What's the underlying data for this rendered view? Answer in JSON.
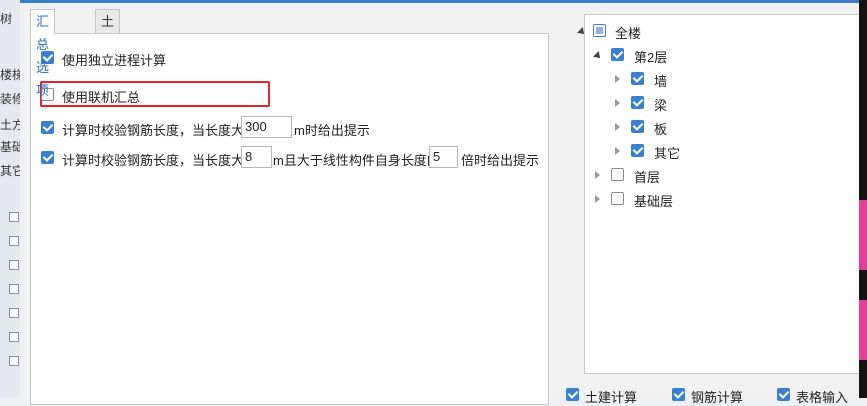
{
  "background_app": {
    "top_label": "树",
    "items": [
      "楼梯",
      "装修",
      "土方",
      "基础",
      "其它"
    ]
  },
  "dialog": {
    "tabs": [
      {
        "label": "汇总选项",
        "active": true
      },
      {
        "label": "土建工程量选择",
        "active": false
      }
    ],
    "options": {
      "independent_process": {
        "label": "使用独立进程计算",
        "checked": true
      },
      "online_summary": {
        "label": "使用联机汇总",
        "checked": false,
        "highlighted": true
      },
      "rebar_length_check_1": {
        "label_before": "计算时校验钢筋长度，当长度大于",
        "value": "300",
        "label_after": "m时给出提示",
        "checked": true
      },
      "rebar_length_check_2": {
        "label_before": "计算时校验钢筋长度，当长度大于",
        "value1": "8",
        "label_middle": "m且大于线性构件自身长度的",
        "value2": "5",
        "label_after": "倍时给出提示",
        "checked": true
      }
    },
    "tree": {
      "root": {
        "label": "全楼",
        "state": "partial",
        "expanded": true
      },
      "floor2": {
        "label": "第2层",
        "state": "checked",
        "expanded": true
      },
      "children": [
        {
          "label": "墙",
          "state": "checked"
        },
        {
          "label": "梁",
          "state": "checked"
        },
        {
          "label": "板",
          "state": "checked"
        },
        {
          "label": "其它",
          "state": "checked"
        }
      ],
      "floor1": {
        "label": "首层",
        "state": "unchecked",
        "expanded": false
      },
      "foundation": {
        "label": "基础层",
        "state": "unchecked",
        "expanded": false
      }
    },
    "bottom": [
      {
        "label": "土建计算",
        "checked": true
      },
      {
        "label": "钢筋计算",
        "checked": true
      },
      {
        "label": "表格输入",
        "checked": true
      }
    ]
  },
  "colors": {
    "accent": "#3a7fd0",
    "highlight": "#e3252b",
    "title_bar": "#3c7dc4"
  }
}
